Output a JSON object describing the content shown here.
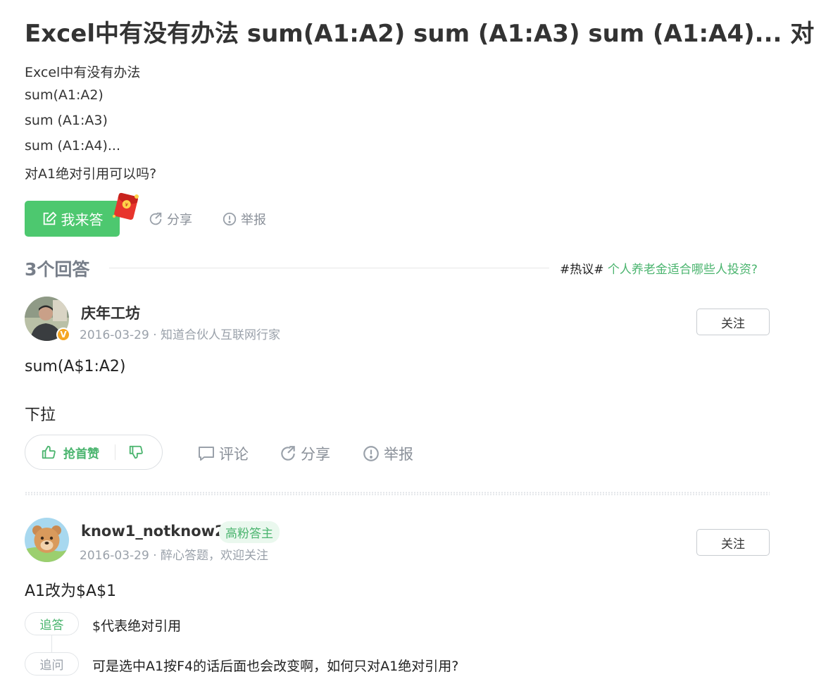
{
  "question": {
    "title": "Excel中有没有办法 sum(A1:A2) sum (A1:A3) sum (A1:A4)... 对",
    "body_lines": [
      "Excel中有没有办法",
      "sum(A1:A2)",
      "sum (A1:A3)",
      "sum (A1:A4)...",
      "对A1绝对引用可以吗?"
    ],
    "actions": {
      "answer_label": "我来答",
      "share_label": "分享",
      "report_label": "举报"
    }
  },
  "answers_header": {
    "count_label": "3个回答",
    "hot_tag": "#热议#",
    "hot_link": "个人养老金适合哪些人投资?"
  },
  "answers": [
    {
      "username": "庆年工坊",
      "meta": "2016-03-29 · 知道合伙人互联网行家",
      "verified_badge": "V",
      "follow_label": "关注",
      "content": [
        "sum(A$1:A2)",
        "下拉"
      ],
      "vote_label": "抢首赞",
      "comment_label": "评论",
      "share_label": "分享",
      "report_label": "举报"
    },
    {
      "username": "know1_notknow2",
      "badge": "高粉答主",
      "meta": "2016-03-29 · 醉心答题，欢迎关注",
      "follow_label": "关注",
      "content": [
        "A1改为$A$1"
      ],
      "followups": [
        {
          "type": "追答",
          "text": "$代表绝对引用"
        },
        {
          "type": "追问",
          "text": "可是选中A1按F4的话后面也会改变啊，如何只对A1绝对引用?"
        }
      ]
    }
  ],
  "colors": {
    "brand_green": "#4dc86f",
    "link_green": "#4ab46e",
    "muted_grey": "#8a9099",
    "verified_orange": "#f5a623"
  },
  "icons": {
    "answer": "edit-icon",
    "share": "share-icon",
    "report": "report-icon",
    "comment": "comment-icon",
    "thumb_up": "thumb-up-icon",
    "thumb_down": "thumb-down-icon",
    "redpacket": "red-packet-icon"
  }
}
